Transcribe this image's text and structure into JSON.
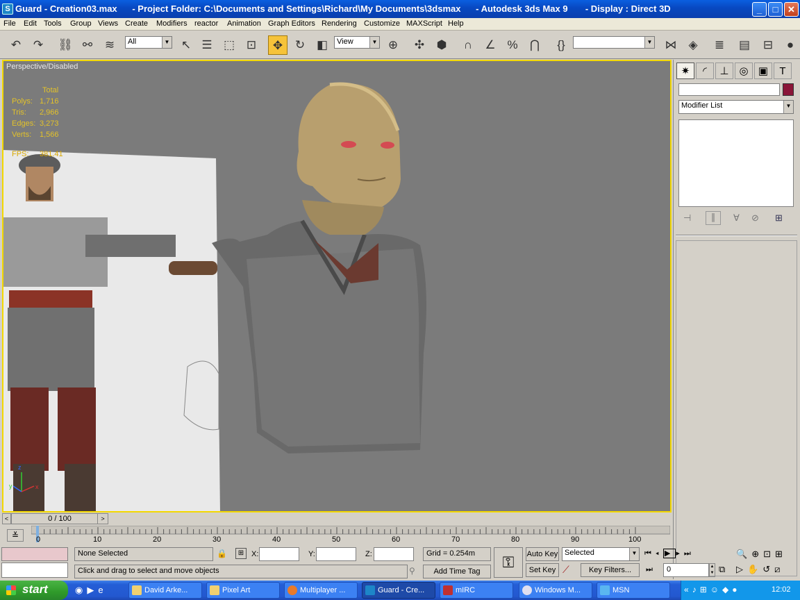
{
  "window": {
    "title": "Guard - Creation03.max      - Project Folder: C:\\Documents and Settings\\Richard\\My Documents\\3dsmax      - Autodesk 3ds Max 9       - Display : Direct 3D",
    "buttons": {
      "minimize": "_",
      "maximize": "□",
      "close": "✕"
    }
  },
  "menu": [
    "File",
    "Edit",
    "Tools",
    "Group",
    "Views",
    "Create",
    "Modifiers",
    "reactor",
    "Animation",
    "Graph Editors",
    "Rendering",
    "Customize",
    "MAXScript",
    "Help"
  ],
  "toolbar": {
    "selection_filter": "All",
    "reference_coord": "View",
    "named_selection": ""
  },
  "viewport": {
    "label": "Perspective/Disabled",
    "stats": {
      "header": "Total",
      "rows": [
        {
          "label": "Polys:",
          "value": "1,716"
        },
        {
          "label": "Tris:",
          "value": "2,966"
        },
        {
          "label": "Edges:",
          "value": "3,273"
        },
        {
          "label": "Verts:",
          "value": "1,566"
        }
      ],
      "fps_label": "FPS:",
      "fps_value": "381.41"
    },
    "axis": {
      "x": "x",
      "y": "y",
      "z": "z"
    }
  },
  "command_panel": {
    "modifier_list": "Modifier List",
    "object_name": "",
    "object_color": "#8a1538"
  },
  "timeline": {
    "slider": "0 / 100",
    "ticks": [
      "0",
      "10",
      "20",
      "30",
      "40",
      "50",
      "60",
      "70",
      "80",
      "90",
      "100"
    ]
  },
  "status": {
    "selection": "None Selected",
    "prompt": "Click and drag to select and move objects",
    "x_label": "X:",
    "y_label": "Y:",
    "z_label": "Z:",
    "x_value": "",
    "y_value": "",
    "z_value": "",
    "grid": "Grid = 0.254m",
    "add_time_tag": "Add Time Tag",
    "auto_key": "Auto Key",
    "set_key": "Set Key",
    "key_mode": "Selected",
    "key_filters": "Key Filters...",
    "frame": "0"
  },
  "taskbar": {
    "start": "start",
    "tasks": [
      "David Arke...",
      "Pixel Art",
      "Multiplayer ...",
      "Guard - Cre...",
      "mIRC",
      "Windows M...",
      "MSN"
    ],
    "clock": "12:02"
  }
}
